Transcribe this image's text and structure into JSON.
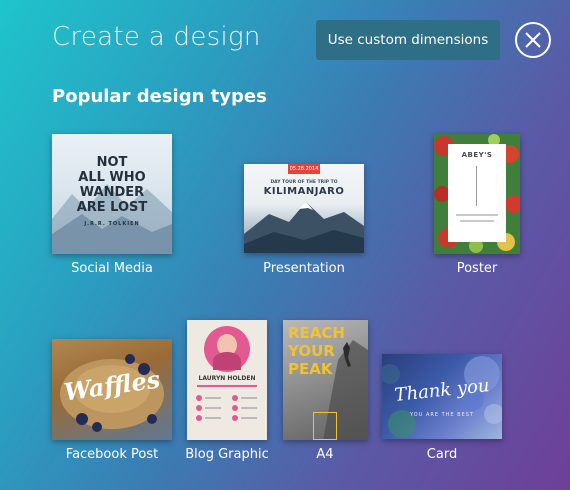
{
  "header": {
    "title": "Create a design",
    "custom_button": "Use custom dimensions",
    "close_icon": "close-icon"
  },
  "section_title": "Popular design types",
  "designs": [
    {
      "label": "Social Media",
      "thumb_text": [
        "NOT",
        "ALL WHO",
        "WANDER",
        "ARE LOST"
      ],
      "thumb_sub": "J.R.R. TOLKIEN"
    },
    {
      "label": "Presentation",
      "thumb_date": "05.28.2014",
      "thumb_small": "DAY TOUR OF THE TRIP TO",
      "thumb_title": "KILIMANJARO"
    },
    {
      "label": "Poster",
      "thumb_title": "ABEY'S"
    },
    {
      "label": "Facebook Post",
      "thumb_title": "Waffles"
    },
    {
      "label": "Blog Graphic",
      "thumb_title": "LAURYN HOLDEN"
    },
    {
      "label": "A4",
      "thumb_lines": [
        "REACH",
        "YOUR",
        "PEAK"
      ]
    },
    {
      "label": "Card",
      "thumb_title": "Thank you",
      "thumb_sub": "YOU ARE THE BEST"
    }
  ],
  "colors": {
    "button_bg": "#2f6f86",
    "accent_red": "#e0463c",
    "poster_green": "#3f7f3a",
    "a4_yellow": "#f2c230",
    "blog_pink": "#e25a8f"
  }
}
